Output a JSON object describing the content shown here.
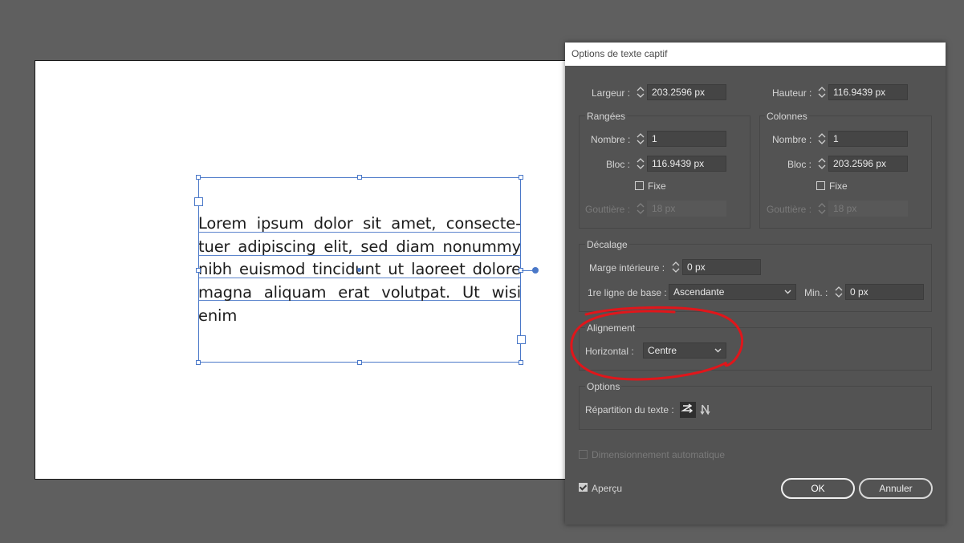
{
  "canvas": {
    "lorem_text": "Lorem ipsum dolor sit amet, consecte-tuer adipiscing elit, sed diam nonummy nibh euismod tincidunt ut laoreet dolore magna aliquam erat volutpat. Ut wisi enim"
  },
  "dialog": {
    "title": "Options de texte captif",
    "size": {
      "width_label": "Largeur :",
      "width_value": "203.2596 px",
      "height_label": "Hauteur :",
      "height_value": "116.9439 px"
    },
    "rows": {
      "title": "Rangées",
      "count_label": "Nombre :",
      "count_value": "1",
      "span_label": "Bloc :",
      "span_value": "116.9439 px",
      "fixed_label": "Fixe",
      "gutter_label": "Gouttière :",
      "gutter_value": "18 px"
    },
    "columns": {
      "title": "Colonnes",
      "count_label": "Nombre :",
      "count_value": "1",
      "span_label": "Bloc :",
      "span_value": "203.2596 px",
      "fixed_label": "Fixe",
      "gutter_label": "Gouttière :",
      "gutter_value": "18 px"
    },
    "offset": {
      "title": "Décalage",
      "inset_label": "Marge intérieure :",
      "inset_value": "0 px",
      "baseline_label": "1re ligne de base :",
      "baseline_value": "Ascendante",
      "min_label": "Min. :",
      "min_value": "0 px"
    },
    "alignment": {
      "title": "Alignement",
      "horizontal_label": "Horizontal :",
      "horizontal_value": "Centre"
    },
    "options": {
      "title": "Options",
      "text_flow_label": "Répartition du texte :"
    },
    "auto_size_label": "Dimensionnement automatique",
    "preview_label": "Aperçu",
    "ok_label": "OK",
    "cancel_label": "Annuler"
  },
  "colors": {
    "selection_blue": "#4a78c8",
    "annotation_red": "#e0161b",
    "dialog_bg": "#535353",
    "workspace_bg": "#5f5f5f"
  }
}
